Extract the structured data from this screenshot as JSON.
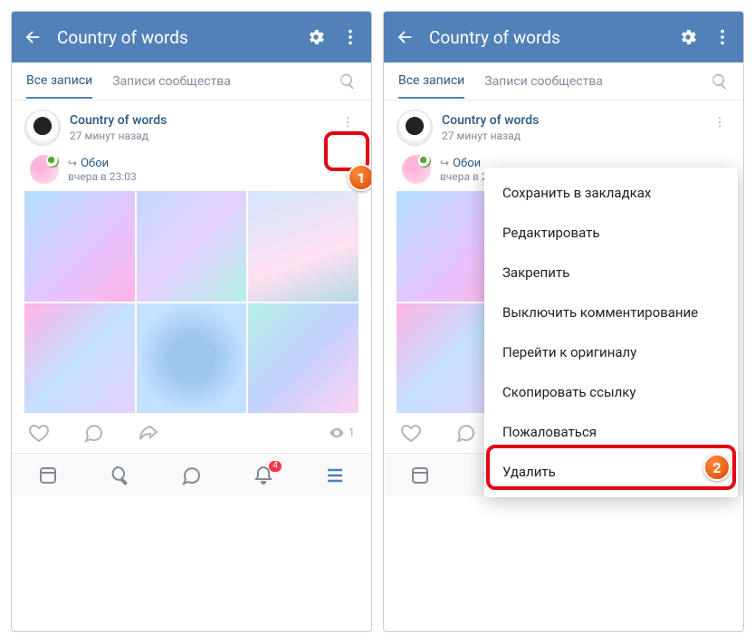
{
  "header": {
    "title": "Country of words"
  },
  "tabs": {
    "all": "Все записи",
    "community": "Записи сообщества"
  },
  "post": {
    "author": "Country of words",
    "time": "27 минут назад",
    "repost_name": "Обои",
    "repost_time": "вчера в 23:03"
  },
  "views": "1",
  "notif_count": "4",
  "menu": {
    "bookmark": "Сохранить в закладках",
    "edit": "Редактировать",
    "pin": "Закрепить",
    "comments_off": "Выключить комментирование",
    "go_original": "Перейти к оригиналу",
    "copy_link": "Скопировать ссылку",
    "report": "Пожаловаться",
    "delete": "Удалить"
  },
  "callouts": {
    "one": "1",
    "two": "2"
  }
}
